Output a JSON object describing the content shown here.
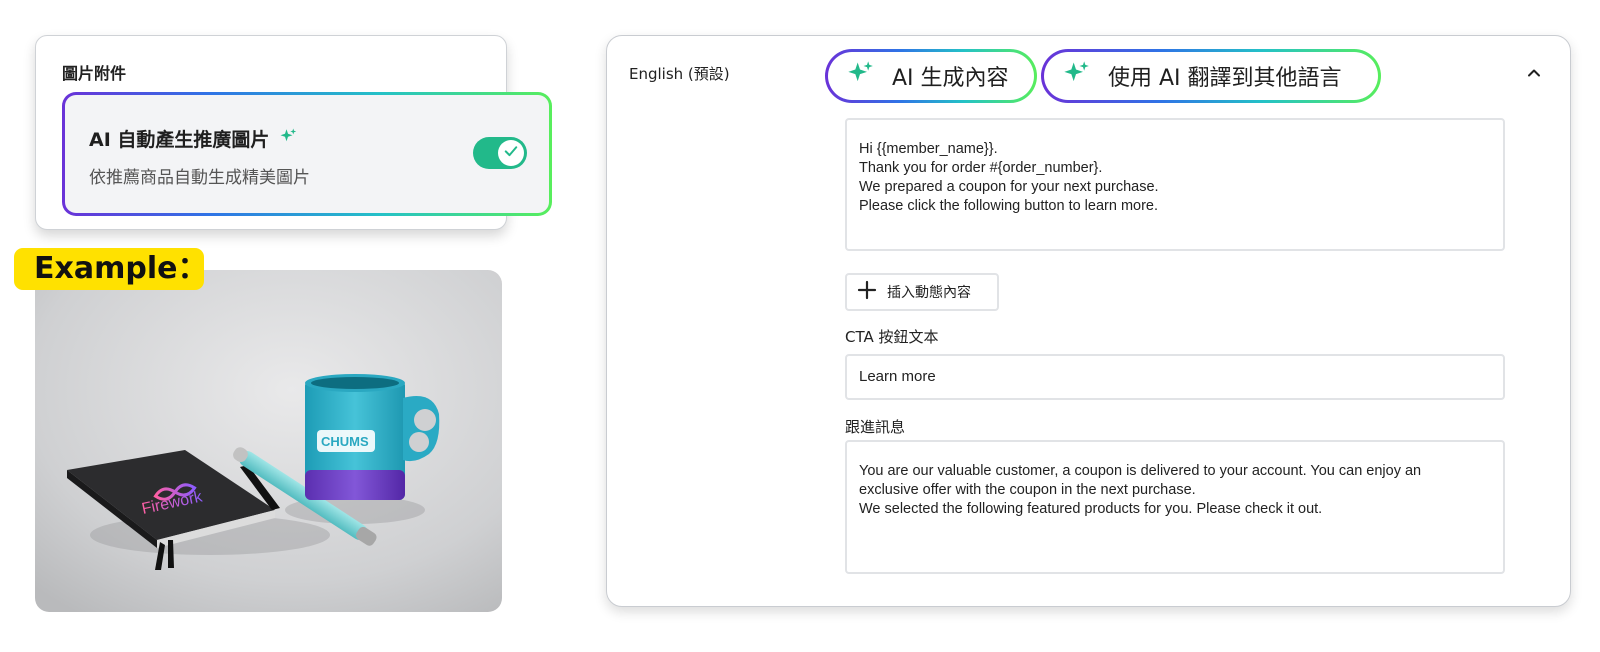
{
  "attachment": {
    "title": "圖片附件",
    "ai_image": {
      "heading": "AI 自動產生推廣圖片",
      "description": "依推薦商品自動生成精美圖片",
      "toggle_on": true
    }
  },
  "example": {
    "label": "Example：",
    "photo": {
      "mug_brand": "CHUMS",
      "notebook_brand": "Firework"
    }
  },
  "editor": {
    "language": "English (預設)",
    "ai_generate_label": "AI 生成內容",
    "ai_translate_label": "使用 AI 翻譯到其他語言",
    "message_lines": [
      "Hi {{member_name}}.",
      "Thank you for order #{order_number}.",
      "We prepared a coupon for your next purchase.",
      "Please click the following button to learn more."
    ],
    "insert_dynamic_label": "插入動態內容",
    "cta_label": "CTA 按鈕文本",
    "cta_value": "Learn more",
    "followup_label": "跟進訊息",
    "followup_lines": [
      "You are our valuable customer, a coupon is delivered to your account. You can enjoy an",
      "exclusive offer with the coupon in the next purchase.",
      "We selected the following featured products for you. Please check it out."
    ]
  },
  "colors": {
    "toggle": "#22b98a",
    "example_tag": "#ffe100",
    "gradient_start": "#6a32d8",
    "gradient_end": "#58ee5c",
    "sparkle": "#22b98a"
  },
  "icons": {
    "sparkle": "sparkle-icon",
    "check": "check-icon",
    "plus": "plus-icon",
    "collapse": "chevron-up-icon"
  }
}
